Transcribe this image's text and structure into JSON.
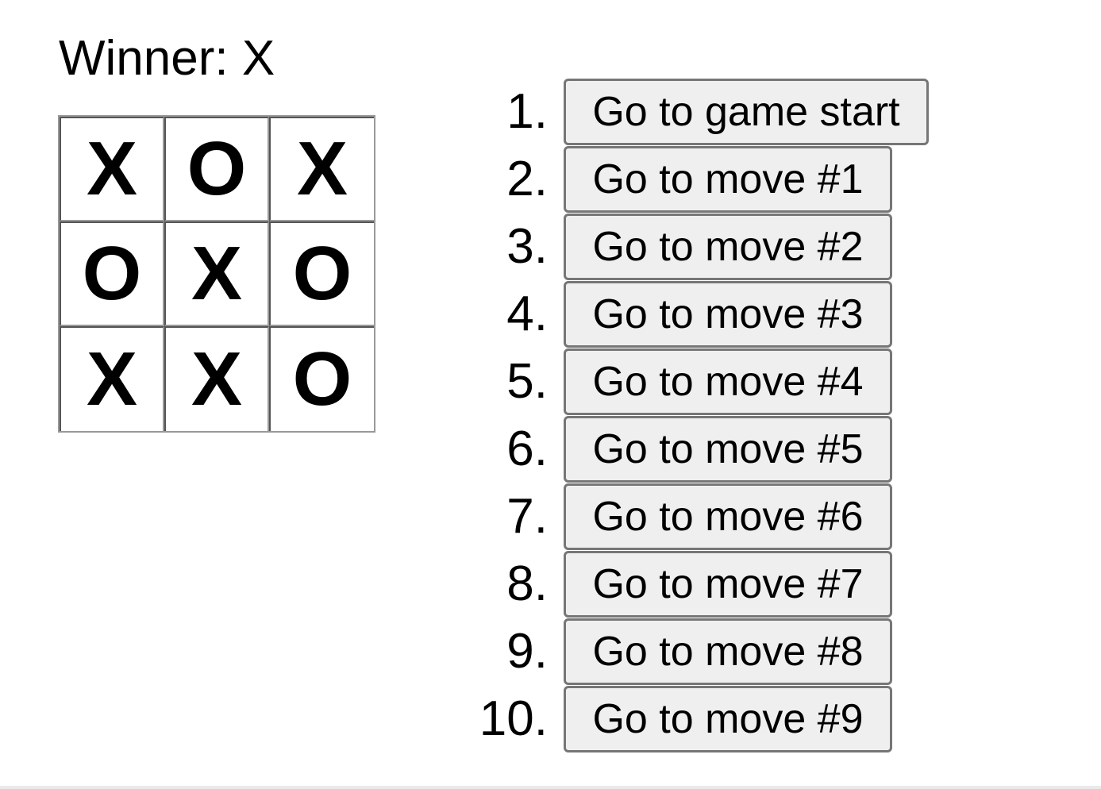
{
  "status": {
    "text": "Winner: X"
  },
  "board": {
    "squares": [
      "X",
      "O",
      "X",
      "O",
      "X",
      "O",
      "X",
      "X",
      "O"
    ]
  },
  "history": {
    "moves": [
      {
        "number": "1.",
        "label": "Go to game start"
      },
      {
        "number": "2.",
        "label": "Go to move #1"
      },
      {
        "number": "3.",
        "label": "Go to move #2"
      },
      {
        "number": "4.",
        "label": "Go to move #3"
      },
      {
        "number": "5.",
        "label": "Go to move #4"
      },
      {
        "number": "6.",
        "label": "Go to move #5"
      },
      {
        "number": "7.",
        "label": "Go to move #6"
      },
      {
        "number": "8.",
        "label": "Go to move #7"
      },
      {
        "number": "9.",
        "label": "Go to move #8"
      },
      {
        "number": "10.",
        "label": "Go to move #9"
      }
    ]
  },
  "colors": {
    "grid_border": "#999999",
    "button_bg": "#efefef",
    "button_border": "#767676",
    "text": "#000000"
  }
}
